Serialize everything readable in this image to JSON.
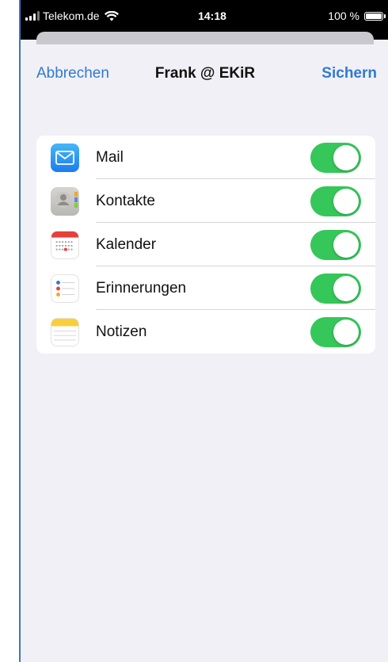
{
  "status_bar": {
    "carrier": "Telekom.de",
    "time": "14:18",
    "battery": "100 %",
    "battery_level": 1.0
  },
  "nav": {
    "cancel_label": "Abbrechen",
    "title": "Frank @ EKiR",
    "save_label": "Sichern"
  },
  "accent_color": "#2f7ad2",
  "toggle_on_color": "#35c759",
  "services": [
    {
      "label": "Mail",
      "icon": "mail-icon",
      "enabled": true
    },
    {
      "label": "Kontakte",
      "icon": "contacts-icon",
      "enabled": true
    },
    {
      "label": "Kalender",
      "icon": "calendar-icon",
      "enabled": true
    },
    {
      "label": "Erinnerungen",
      "icon": "reminders-icon",
      "enabled": true
    },
    {
      "label": "Notizen",
      "icon": "notes-icon",
      "enabled": true
    }
  ]
}
